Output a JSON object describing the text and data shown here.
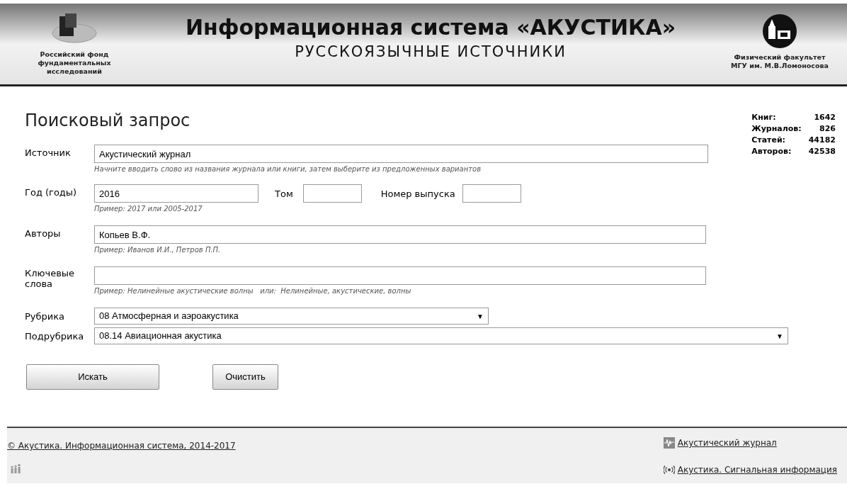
{
  "header": {
    "left_org": "Российский фонд фундаментальных исследований",
    "title": "Информационная система «АКУСТИКА»",
    "subtitle": "РУССКОЯЗЫЧНЫЕ ИСТОЧНИКИ",
    "right_org_line1": "Физический факультет",
    "right_org_line2": "МГУ им. М.В.Ломоносова"
  },
  "page_title": "Поисковый запрос",
  "stats": [
    {
      "label": "Книг:",
      "value": "1642"
    },
    {
      "label": "Журналов:",
      "value": "826"
    },
    {
      "label": "Статей:",
      "value": "44182"
    },
    {
      "label": "Авторов:",
      "value": "42538"
    }
  ],
  "form": {
    "source": {
      "label": "Источник",
      "value": "Акустический журнал",
      "hint": "Начните вводить слово из названия журнала или книги, затем выберите из предложенных вариантов"
    },
    "year": {
      "label": "Год (годы)",
      "value": "2016",
      "hint": "Пример: 2017 или 2005-2017"
    },
    "volume": {
      "label": "Том"
    },
    "issue": {
      "label": "Номер выпуска"
    },
    "authors": {
      "label": "Авторы",
      "value": "Копьев В.Ф.",
      "hint": "Пример: Иванов И.И., Петров П.П."
    },
    "keywords": {
      "label": "Ключевые слова",
      "hint": "Пример: Нелинейные акустические волны   или:  Нелинейные, акустические, волны"
    },
    "rubric": {
      "label": "Рубрика",
      "value": "08 Атмосферная и аэроакустика",
      "arrow": "▼"
    },
    "subrubric": {
      "label": "Подрубрика",
      "value": "08.14 Авиационная акустика",
      "arrow": "▼"
    }
  },
  "buttons": [
    "Искать",
    "Очистить"
  ],
  "footer": {
    "copyright": "© Акустика. Информационная система, 2014-2017",
    "links": [
      {
        "kind": "journal",
        "label": "Акустический журнал"
      },
      {
        "kind": "signal",
        "label": "Акустика. Сигнальная информация"
      }
    ]
  }
}
